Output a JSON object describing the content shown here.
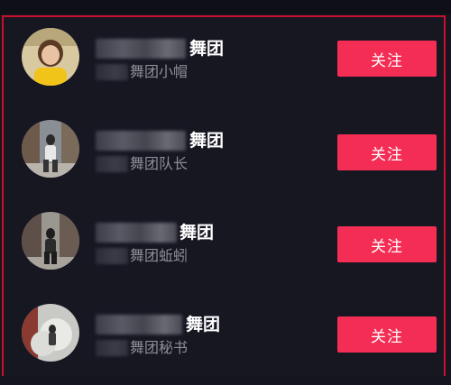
{
  "colors": {
    "background": "#171722",
    "border": "#c8102e",
    "follow_button": "#f42d55"
  },
  "list": [
    {
      "name_suffix": "舞团",
      "subtitle": "舞团小帽",
      "follow_label": "关注",
      "avatar_icon": "avatar-yellow-shirt"
    },
    {
      "name_suffix": "舞团",
      "subtitle": "舞团队长",
      "follow_label": "关注",
      "avatar_icon": "avatar-street-dancer"
    },
    {
      "name_suffix": "舞团",
      "subtitle": "舞团蚯蚓",
      "follow_label": "关注",
      "avatar_icon": "avatar-street-pose"
    },
    {
      "name_suffix": "舞团",
      "subtitle": "舞团秘书",
      "follow_label": "关注",
      "avatar_icon": "avatar-smoke-scene"
    }
  ]
}
